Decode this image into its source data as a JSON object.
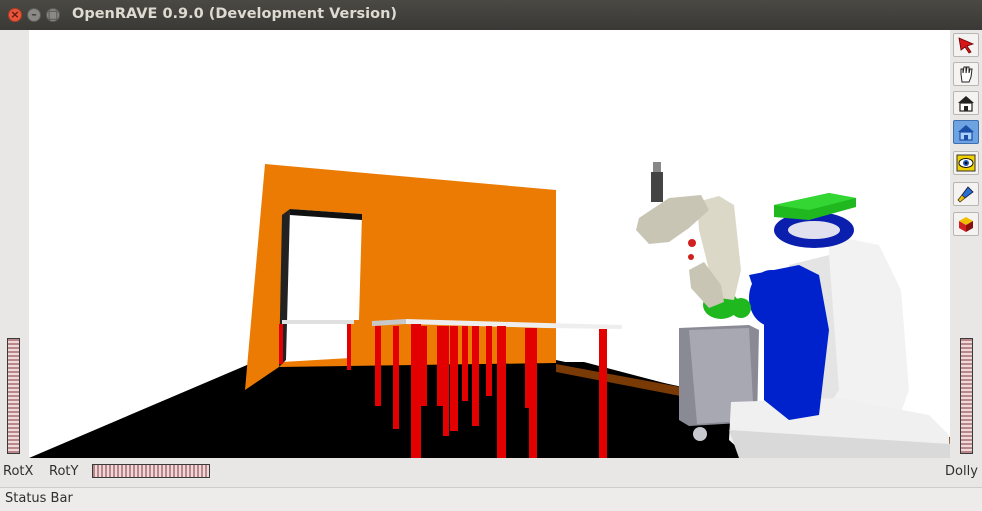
{
  "window": {
    "title": "OpenRAVE 0.9.0 (Development Version)",
    "close_glyph": "×",
    "minimize_glyph": "–",
    "maximize_glyph": "□"
  },
  "toolbar": {
    "tools": [
      {
        "name": "select-tool",
        "icon": "arrow-cursor-icon",
        "active": false
      },
      {
        "name": "pan-tool",
        "icon": "hand-icon",
        "active": false
      },
      {
        "name": "home-tool",
        "icon": "house-icon",
        "active": false
      },
      {
        "name": "set-home-tool",
        "icon": "house-blue-icon",
        "active": true
      },
      {
        "name": "view-all-tool",
        "icon": "eye-icon",
        "active": false
      },
      {
        "name": "seek-tool",
        "icon": "flashlight-icon",
        "active": false
      },
      {
        "name": "projection-tool",
        "icon": "cube-icon",
        "active": false
      }
    ]
  },
  "thumbwheels": {
    "rotx_label": "RotX",
    "roty_label": "RotY",
    "dolly_label": "Dolly"
  },
  "status_bar": {
    "text": "Status Bar"
  },
  "scene_colors": {
    "floor": "#000000",
    "wall": "#eb7b02",
    "table_legs": "#e20000",
    "robot_arm": "#dcd8c8",
    "robot_blue": "#0022cc",
    "robot_green": "#1fb81f",
    "robot_body": "#f0f0f0"
  }
}
